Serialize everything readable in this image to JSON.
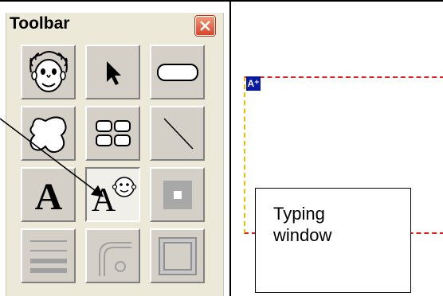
{
  "toolbar": {
    "title": "Toolbar",
    "tools": [
      {
        "icon": "face-icon"
      },
      {
        "icon": "arrow-pointer-icon"
      },
      {
        "icon": "rounded-rectangle-icon"
      },
      {
        "icon": "freeform-shape-icon"
      },
      {
        "icon": "grid-icon"
      },
      {
        "icon": "line-icon"
      },
      {
        "icon": "text-tool-icon",
        "glyph": "A"
      },
      {
        "icon": "text-face-icon",
        "glyph": "A"
      },
      {
        "icon": "square-button-icon"
      },
      {
        "icon": "horizontal-lines-icon"
      },
      {
        "icon": "rounded-corner-icon"
      },
      {
        "icon": "frame-icon"
      }
    ]
  },
  "canvas": {
    "badge_label": "A⁺",
    "callout_lines": [
      "Typing",
      "window"
    ]
  },
  "colors": {
    "badge_bg": "#0a1aa0",
    "frame_dash_red": "#e02020",
    "frame_dash_yellow": "#e8c000"
  }
}
